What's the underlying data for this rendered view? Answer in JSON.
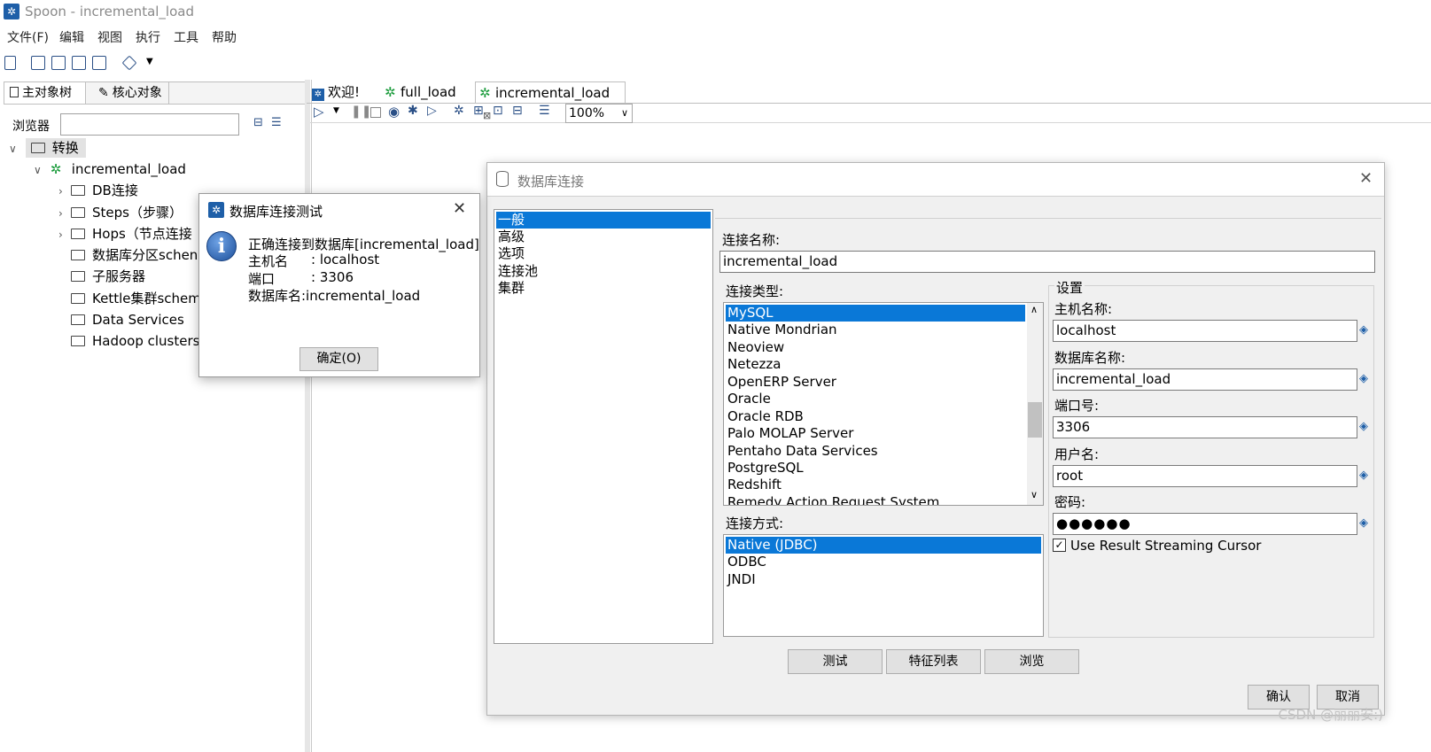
{
  "window": {
    "title": "Spoon - incremental_load"
  },
  "menu": [
    "文件(F)",
    "编辑",
    "视图",
    "执行",
    "工具",
    "帮助"
  ],
  "left_panel": {
    "tabs": [
      "主对象树",
      "核心对象"
    ],
    "browser_label": "浏览器",
    "browser_value": "",
    "tree": {
      "root": "转换",
      "transformation": "incremental_load",
      "nodes": [
        "DB连接",
        "Steps（步骤）",
        "Hops（节点连接",
        "数据库分区schen",
        "子服务器",
        "Kettle集群schem",
        "Data Services",
        "Hadoop clusters"
      ]
    }
  },
  "editor": {
    "tabs": [
      "欢迎!",
      "full_load",
      "incremental_load"
    ],
    "zoom": "100%"
  },
  "db_dialog": {
    "title": "数据库连接",
    "categories": [
      "一般",
      "高级",
      "选项",
      "连接池",
      "集群"
    ],
    "selected_category": "一般",
    "connection_name_label": "连接名称:",
    "connection_name": "incremental_load",
    "connection_type_label": "连接类型:",
    "connection_types": [
      "MySQL",
      "Native Mondrian",
      "Neoview",
      "Netezza",
      "OpenERP Server",
      "Oracle",
      "Oracle RDB",
      "Palo MOLAP Server",
      "Pentaho Data Services",
      "PostgreSQL",
      "Redshift",
      "Remedy Action Request System"
    ],
    "selected_type": "MySQL",
    "access_label": "连接方式:",
    "access_methods": [
      "Native (JDBC)",
      "ODBC",
      "JNDI"
    ],
    "selected_access": "Native (JDBC)",
    "settings": {
      "group_label": "设置",
      "host_label": "主机名称:",
      "host": "localhost",
      "db_label": "数据库名称:",
      "db": "incremental_load",
      "port_label": "端口号:",
      "port": "3306",
      "user_label": "用户名:",
      "user": "root",
      "password_label": "密码:",
      "password": "●●●●●●",
      "streaming_label": "Use Result Streaming Cursor",
      "streaming_checked": true
    },
    "buttons": {
      "test": "测试",
      "features": "特征列表",
      "explore": "浏览",
      "ok": "确认",
      "cancel": "取消"
    }
  },
  "test_dialog": {
    "title": "数据库连接测试",
    "line1": "正确连接到数据库[incremental_load]",
    "host_label": "主机名",
    "host_value": ": localhost",
    "port_label": "端口",
    "port_value": ": 3306",
    "db_line": "数据库名:incremental_load",
    "ok_button": "确定(O)"
  },
  "watermark": "CSDN @丽丽安:)"
}
